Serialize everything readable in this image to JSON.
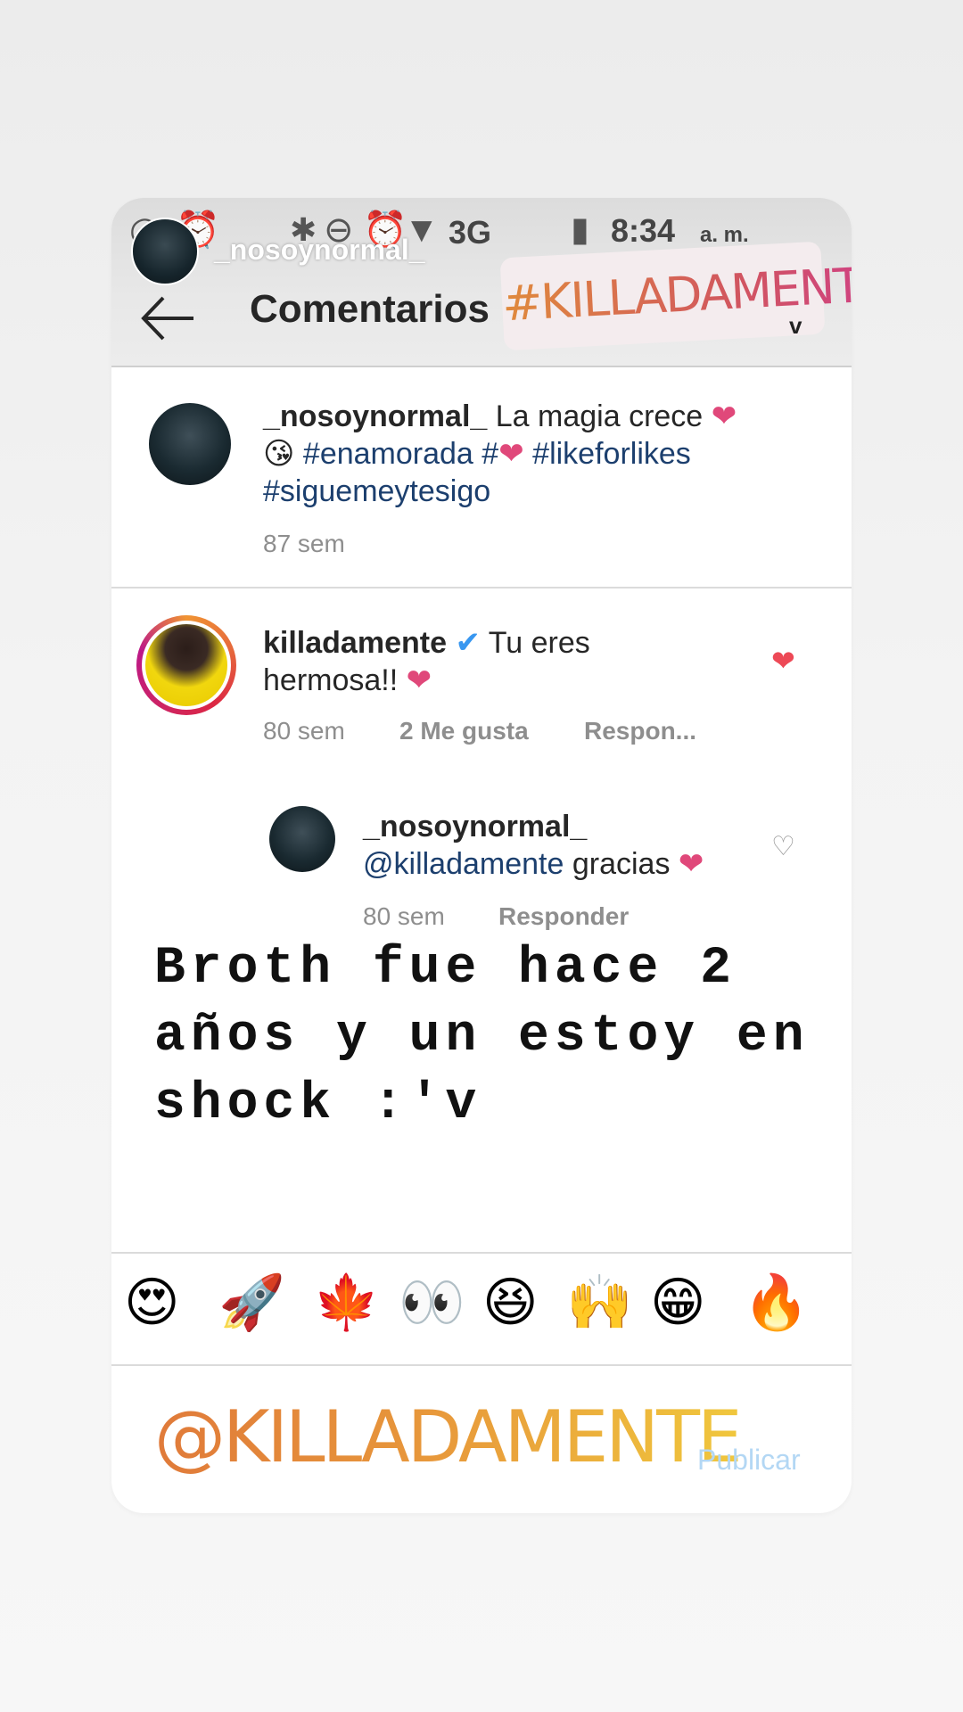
{
  "status_bar": {
    "network": "3G",
    "time": "8:34",
    "ampm": "a. m."
  },
  "story": {
    "username": "_nosoynormal_"
  },
  "header": {
    "title": "Comentarios",
    "hashtag_sticker": "#KILLADAMENTE",
    "small_mark": "v"
  },
  "caption": {
    "username": "_nosoynormal_",
    "text": "La magia crece",
    "tags": [
      "#enamorada",
      "#",
      "#likeforlikes",
      "#siguemeytesigo"
    ],
    "time": "87 sem"
  },
  "comment": {
    "username": "killadamente",
    "text_line1": "Tu eres",
    "text_line2": "hermosa!!",
    "time": "80 sem",
    "likes": "2 Me gusta",
    "reply": "Respon..."
  },
  "reply": {
    "username": "_nosoynormal_",
    "mention": "@killadamente",
    "text": "gracias",
    "time": "80 sem",
    "reply_label": "Responder"
  },
  "overlay_text": "Broth fue hace 2\naños y un estoy en\nshock :'v",
  "emoji_bar": [
    "😍",
    "🚀",
    "🍁",
    "👀",
    "😆",
    "🙌",
    "😁",
    "🔥"
  ],
  "input": {
    "mention_sticker": "@KILLADAMENTE",
    "publish_label": "Publicar"
  },
  "colors": {
    "heart": "#e0487a",
    "link": "#1c3f6e",
    "publish_disabled": "#b3d7f4"
  }
}
